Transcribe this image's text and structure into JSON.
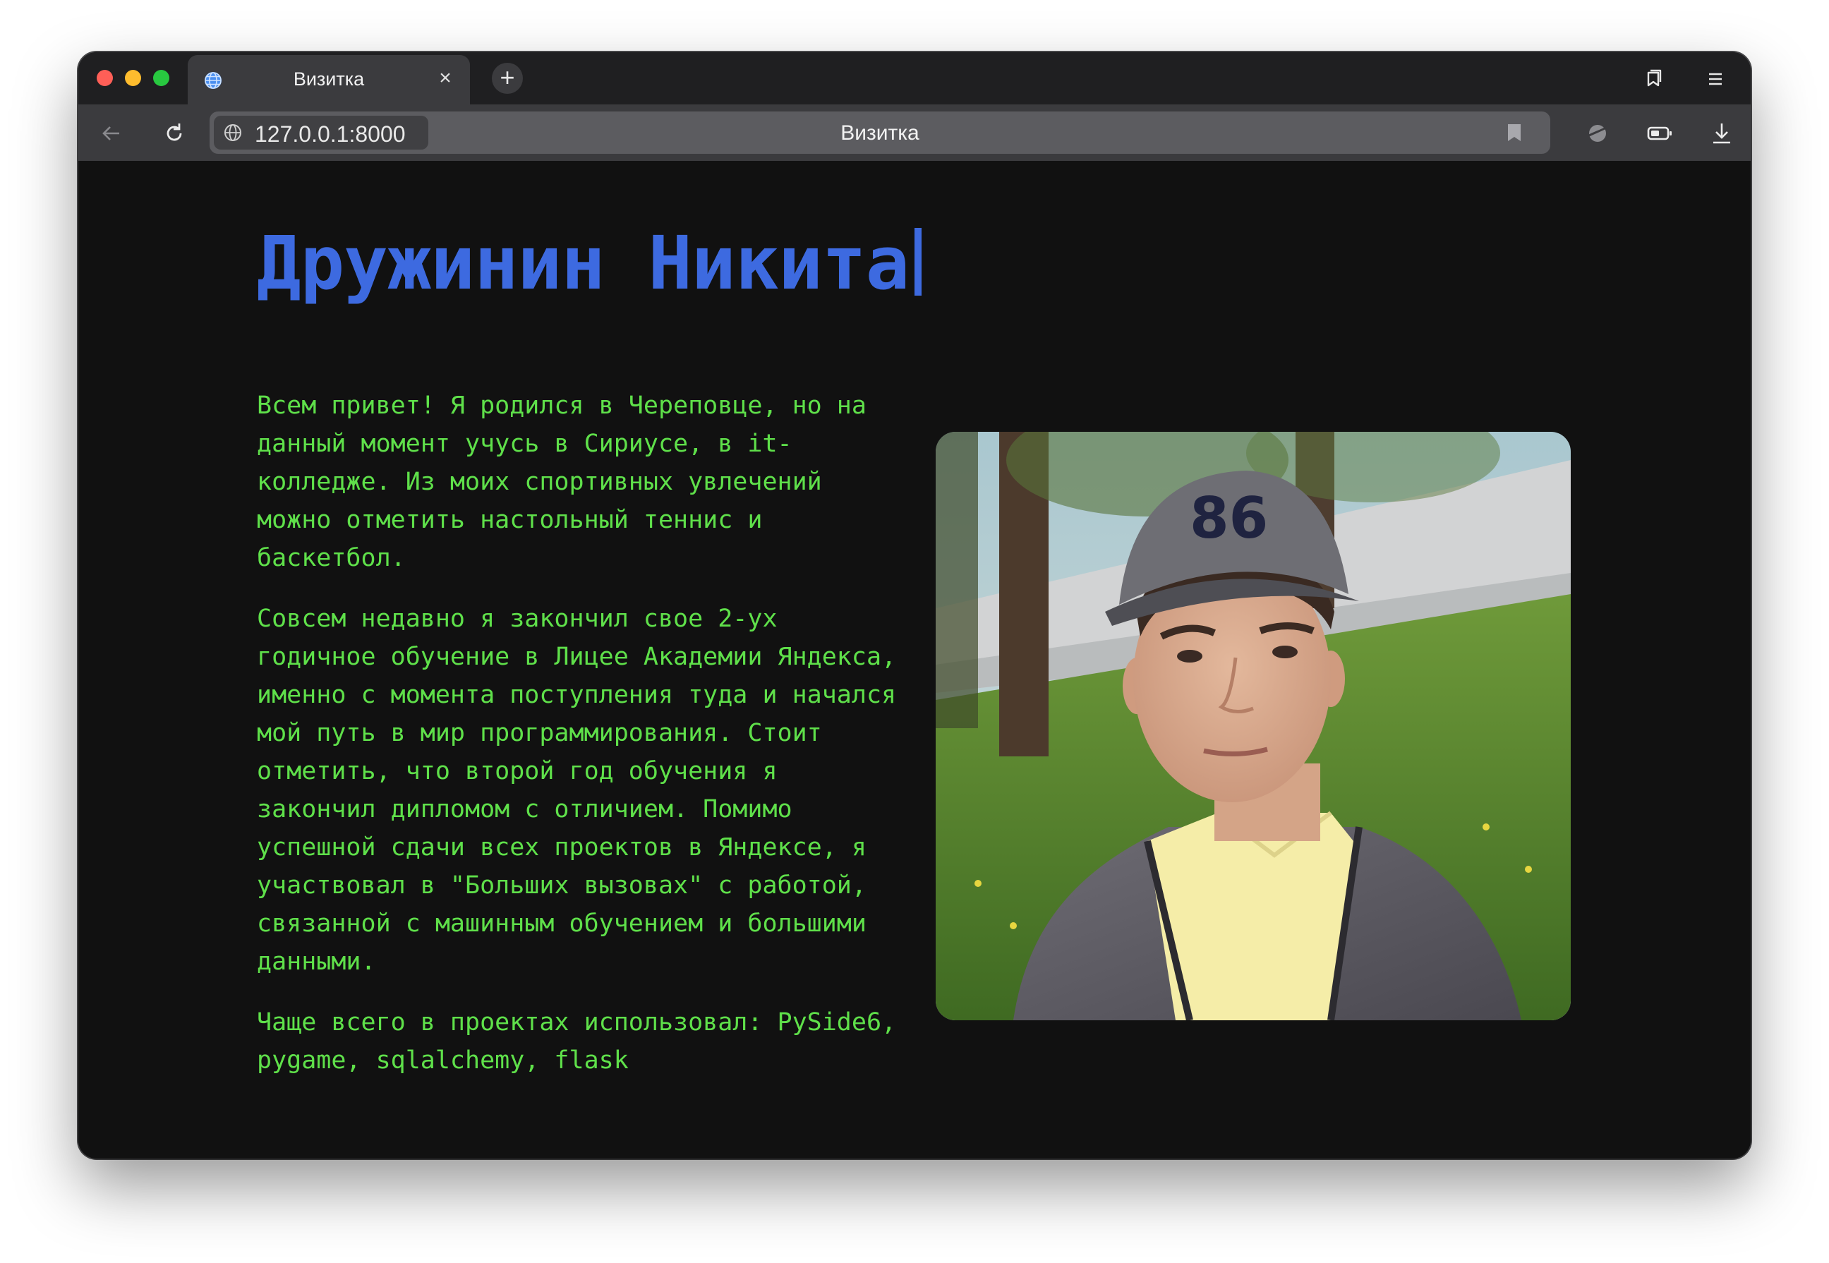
{
  "browser": {
    "tab": {
      "title": "Визитка",
      "favicon": "globe-icon",
      "close": "×"
    },
    "new_tab": "+",
    "address": {
      "url": "127.0.0.1:8000",
      "page_title": "Визитка"
    },
    "icons": [
      "back-arrow-icon",
      "reload-icon",
      "globe-icon",
      "bookmark-icon",
      "vpn-icon",
      "battery-icon",
      "download-icon",
      "tabs-icon",
      "menu-icon"
    ]
  },
  "page": {
    "name": "Дружинин Никита",
    "paragraphs": [
      "Всем привет! Я родился в Череповце, но на данный момент учусь в Сириусе, в it-колледже. Из моих спортивных увлечений можно отметить настольный теннис и баскетбол.",
      "Совсем недавно я закончил свое 2-ух годичное обучение в Лицее Академии Яндекса, именно с момента поступления туда и начался мой путь в мир программирования. Стоит отметить, что второй год обучения я закончил дипломом с отличием. Помимо успешной сдачи всех проектов в Яндексе, я участвовал в \"Больших вызовах\" с работой, связанной с машинным обучением и большими данными.",
      "Чаще всего в проектах использовал: PySide6, pygame, sqlalchemy, flask"
    ],
    "photo": "portrait-photo"
  },
  "colors": {
    "background": "#111111",
    "heading": "#3d6ae0",
    "text": "#5fe04a"
  }
}
